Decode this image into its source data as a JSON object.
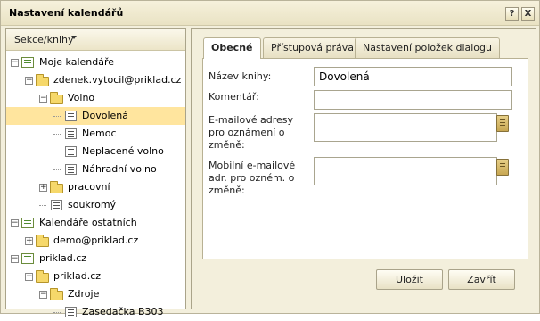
{
  "dialog": {
    "title": "Nastavení kalendářů",
    "help_label": "?",
    "close_label": "X"
  },
  "sidebar": {
    "header": "Sekce/knihy",
    "tree": [
      {
        "label": "Moje kalendáře",
        "type": "root",
        "expander": "−",
        "level": 0
      },
      {
        "label": "zdenek.vytocil@priklad.cz",
        "type": "folder",
        "expander": "−",
        "level": 1
      },
      {
        "label": "Volno",
        "type": "folder",
        "expander": "−",
        "level": 2
      },
      {
        "label": "Dovolená",
        "type": "calendar",
        "level": 3,
        "selected": true
      },
      {
        "label": "Nemoc",
        "type": "calendar",
        "level": 3
      },
      {
        "label": "Neplacené volno",
        "type": "calendar",
        "level": 3
      },
      {
        "label": "Náhradní volno",
        "type": "calendar",
        "level": 3
      },
      {
        "label": "pracovní",
        "type": "folder",
        "expander": "+",
        "level": 2
      },
      {
        "label": "soukromý",
        "type": "calendar",
        "level": 2
      },
      {
        "label": "Kalendáře ostatních",
        "type": "root",
        "expander": "−",
        "level": 0
      },
      {
        "label": "demo@priklad.cz",
        "type": "folder",
        "expander": "+",
        "level": 1
      },
      {
        "label": "priklad.cz",
        "type": "root",
        "expander": "−",
        "level": 0
      },
      {
        "label": "priklad.cz",
        "type": "folder",
        "expander": "−",
        "level": 1
      },
      {
        "label": "Zdroje",
        "type": "folder",
        "expander": "−",
        "level": 2
      },
      {
        "label": "Zasedačka B303",
        "type": "calendar",
        "level": 3
      }
    ]
  },
  "tabs": [
    {
      "label": "Obecné",
      "active": true
    },
    {
      "label": "Přístupová práva",
      "active": false
    },
    {
      "label": "Nastavení položek dialogu",
      "active": false
    }
  ],
  "form": {
    "name_label": "Název knihy:",
    "name_value": "Dovolená",
    "comment_label": "Komentář:",
    "comment_value": "",
    "email_label": "E-mailové adresy pro oznámení o změně:",
    "email_value": "",
    "mobile_label": "Mobilní e-mailové adr. pro ozném. o změně:",
    "mobile_value": ""
  },
  "buttons": {
    "save": "Uložit",
    "close": "Zavřít"
  }
}
